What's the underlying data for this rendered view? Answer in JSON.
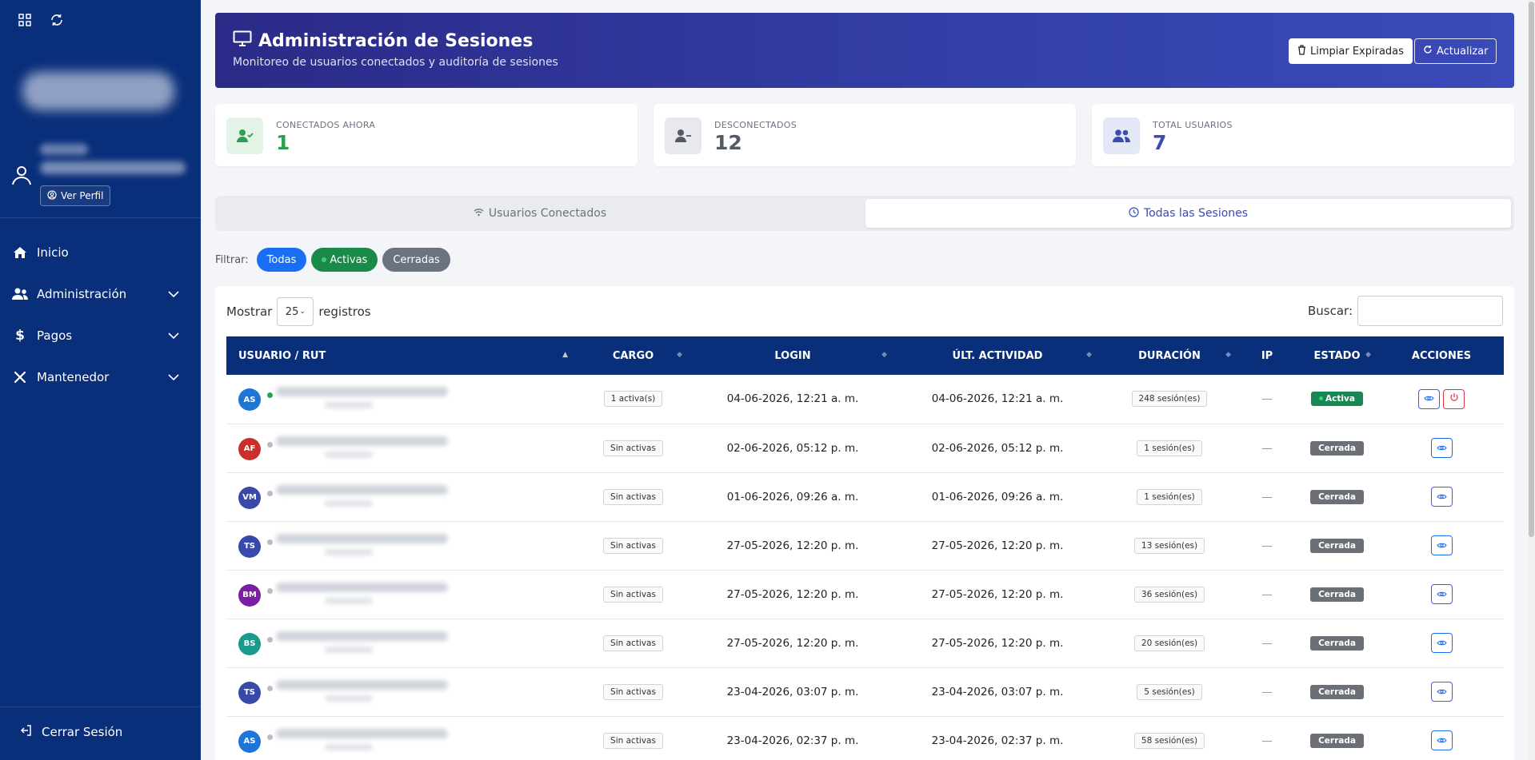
{
  "sidebar": {
    "ver_perfil": "Ver Perfil",
    "nav": [
      {
        "label": "Inicio",
        "icon": "home-icon"
      },
      {
        "label": "Administración",
        "icon": "users-icon"
      },
      {
        "label": "Pagos",
        "icon": "dollar-icon"
      },
      {
        "label": "Mantenedor",
        "icon": "tools-icon"
      }
    ],
    "logout": "Cerrar Sesión"
  },
  "header": {
    "title": "Administración de Sesiones",
    "subtitle": "Monitoreo de usuarios conectados y auditoría de sesiones",
    "clean_btn": "Limpiar Expiradas",
    "refresh_btn": "Actualizar"
  },
  "stats": [
    {
      "label": "CONECTADOS AHORA",
      "value": "1",
      "color": "#2e9e4f"
    },
    {
      "label": "DESCONECTADOS",
      "value": "12",
      "color": "#555b66"
    },
    {
      "label": "TOTAL USUARIOS",
      "value": "7",
      "color": "#3b4bb0"
    }
  ],
  "tabs": {
    "connected": "Usuarios Conectados",
    "all": "Todas las Sesiones"
  },
  "filter": {
    "label": "Filtrar:",
    "all": "Todas",
    "active": "Activas",
    "closed": "Cerradas"
  },
  "table_controls": {
    "show": "Mostrar",
    "show_value": "25",
    "records": "registros",
    "search": "Buscar:"
  },
  "columns": [
    "USUARIO / RUT",
    "CARGO",
    "LOGIN",
    "ÚLT. ACTIVIDAD",
    "DURACIÓN",
    "IP",
    "ESTADO",
    "ACCIONES"
  ],
  "rows": [
    {
      "initials": "AS",
      "color": "#1f74d8",
      "online": true,
      "cargo": "1 activa(s)",
      "login": "04-06-2026, 12:21 a. m.",
      "last": "04-06-2026, 12:21 a. m.",
      "duration": "248 sesión(es)",
      "ip": "—",
      "estado": "Activa"
    },
    {
      "initials": "AF",
      "color": "#c9302c",
      "online": false,
      "cargo": "Sin activas",
      "login": "02-06-2026, 05:12 p. m.",
      "last": "02-06-2026, 05:12 p. m.",
      "duration": "1 sesión(es)",
      "ip": "—",
      "estado": "Cerrada"
    },
    {
      "initials": "VM",
      "color": "#3949ab",
      "online": false,
      "cargo": "Sin activas",
      "login": "01-06-2026, 09:26 a. m.",
      "last": "01-06-2026, 09:26 a. m.",
      "duration": "1 sesión(es)",
      "ip": "—",
      "estado": "Cerrada"
    },
    {
      "initials": "TS",
      "color": "#3949ab",
      "online": false,
      "cargo": "Sin activas",
      "login": "27-05-2026, 12:20 p. m.",
      "last": "27-05-2026, 12:20 p. m.",
      "duration": "13 sesión(es)",
      "ip": "—",
      "estado": "Cerrada"
    },
    {
      "initials": "BM",
      "color": "#7b1fa2",
      "online": false,
      "cargo": "Sin activas",
      "login": "27-05-2026, 12:20 p. m.",
      "last": "27-05-2026, 12:20 p. m.",
      "duration": "36 sesión(es)",
      "ip": "—",
      "estado": "Cerrada"
    },
    {
      "initials": "BS",
      "color": "#1a9a8e",
      "online": false,
      "cargo": "Sin activas",
      "login": "27-05-2026, 12:20 p. m.",
      "last": "27-05-2026, 12:20 p. m.",
      "duration": "20 sesión(es)",
      "ip": "—",
      "estado": "Cerrada"
    },
    {
      "initials": "TS",
      "color": "#3949ab",
      "online": false,
      "cargo": "Sin activas",
      "login": "23-04-2026, 03:07 p. m.",
      "last": "23-04-2026, 03:07 p. m.",
      "duration": "5 sesión(es)",
      "ip": "—",
      "estado": "Cerrada"
    },
    {
      "initials": "AS",
      "color": "#1f74d8",
      "online": false,
      "cargo": "Sin activas",
      "login": "23-04-2026, 02:37 p. m.",
      "last": "23-04-2026, 02:37 p. m.",
      "duration": "58 sesión(es)",
      "ip": "—",
      "estado": "Cerrada"
    }
  ]
}
